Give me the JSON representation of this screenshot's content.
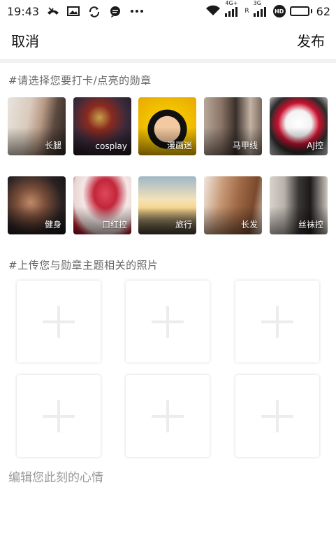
{
  "status_bar": {
    "time": "19:43",
    "network_4g": "4G+",
    "roaming": "R",
    "network_3g": "3G",
    "hd": "HD",
    "battery_percent": "62",
    "battery_level": 0.62,
    "left_icons": [
      "missed-call-icon",
      "image-notification-icon",
      "sync-icon",
      "message-icon",
      "more-dots-icon"
    ],
    "right_icons": [
      "wifi-icon",
      "signal-4g-icon",
      "signal-3g-icon",
      "hd-voice-icon",
      "battery-icon"
    ]
  },
  "nav": {
    "cancel_label": "取消",
    "publish_label": "发布"
  },
  "badges_section": {
    "title": "#请选择您要打卡/点亮的勋章",
    "badges": [
      {
        "label": "长腿"
      },
      {
        "label": "cosplay"
      },
      {
        "label": "漫画迷"
      },
      {
        "label": "马甲线"
      },
      {
        "label": "AJ控"
      },
      {
        "label": "健身"
      },
      {
        "label": "口红控"
      },
      {
        "label": "旅行"
      },
      {
        "label": "长发"
      },
      {
        "label": "丝袜控"
      }
    ]
  },
  "upload_section": {
    "title": "#上传您与勋章主题相关的照片",
    "slots": 6,
    "icon": "plus-icon"
  },
  "mood": {
    "placeholder": "编辑您此刻的心情"
  }
}
